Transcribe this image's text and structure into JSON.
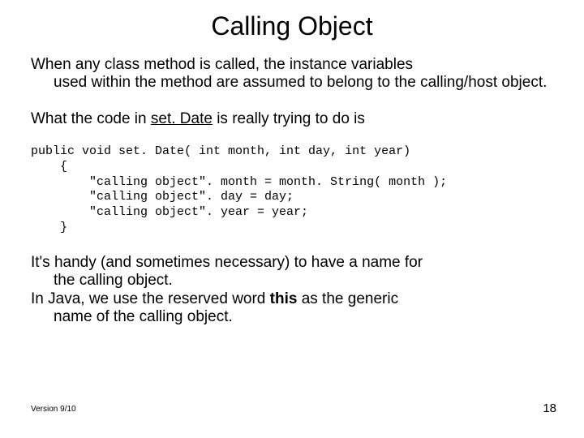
{
  "title": "Calling Object",
  "p1_first": "When any class method is called, the instance variables",
  "p1_rest": "used within the method are assumed to belong to the calling/host object.",
  "p2_a": "What the code in ",
  "p2_method": "set. Date",
  "p2_b": " is really trying to do is",
  "code": "public void set. Date( int month, int day, int year)\n    {\n        \"calling object\". month = month. String( month );\n        \"calling object\". day = day;\n        \"calling object\". year = year;\n    }",
  "p3_first": "It's handy (and sometimes necessary) to have a name for",
  "p3_rest_a": "the calling object.",
  "p3_line2_a": "In Java, we use the reserved word ",
  "p3_this": "this",
  "p3_line2_b": " as the generic",
  "p3_line3": "name of the calling object.",
  "version": "Version 9/10",
  "page": "18"
}
